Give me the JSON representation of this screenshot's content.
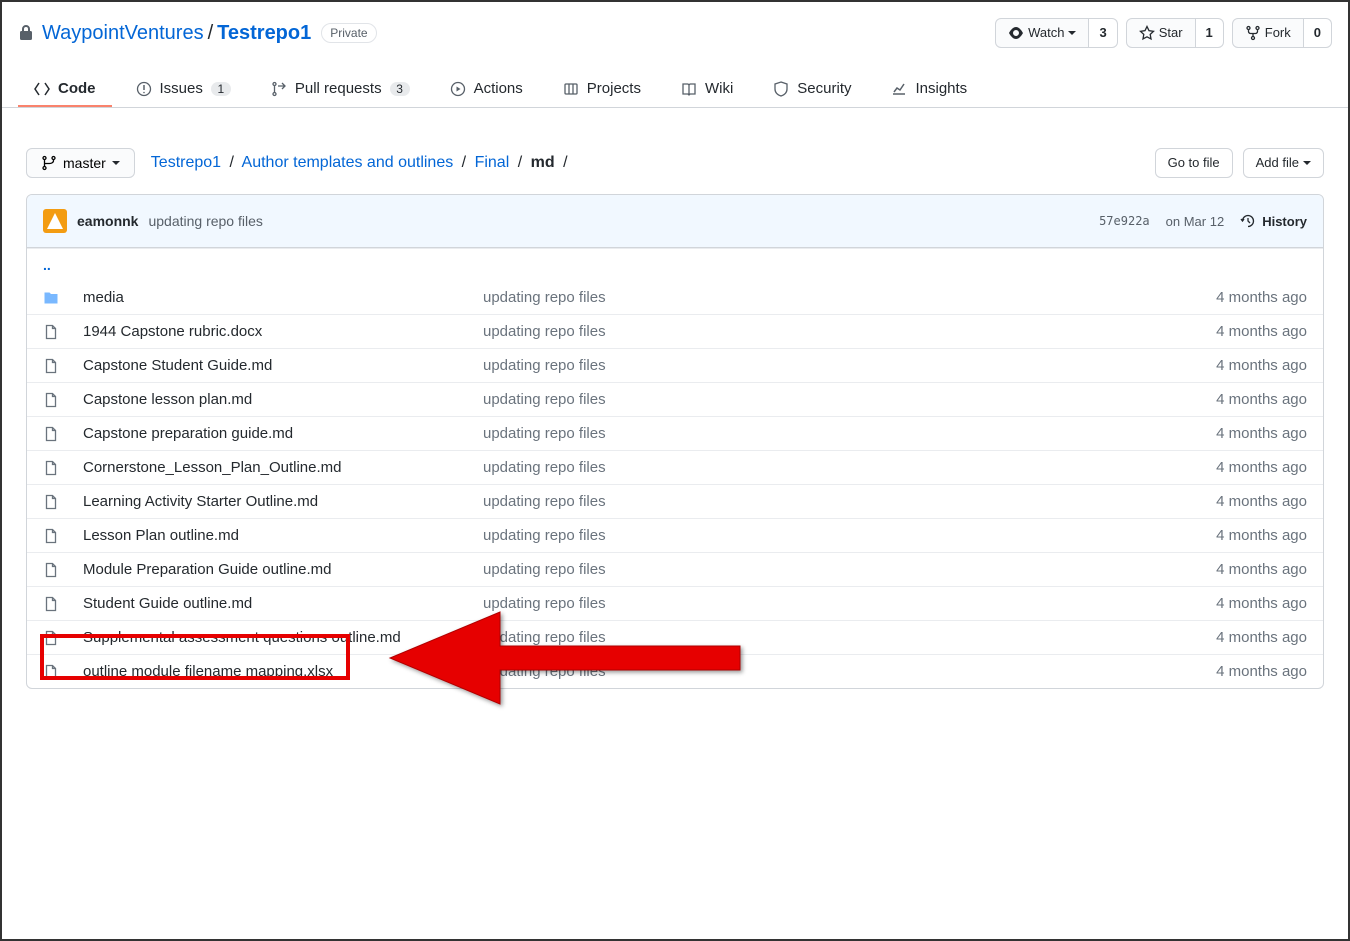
{
  "repo": {
    "owner": "WaypointVentures",
    "name": "Testrepo1",
    "visibility": "Private"
  },
  "actions": {
    "watch": {
      "label": "Watch",
      "count": "3"
    },
    "star": {
      "label": "Star",
      "count": "1"
    },
    "fork": {
      "label": "Fork",
      "count": "0"
    }
  },
  "tabs": [
    {
      "label": "Code"
    },
    {
      "label": "Issues",
      "count": "1"
    },
    {
      "label": "Pull requests",
      "count": "3"
    },
    {
      "label": "Actions"
    },
    {
      "label": "Projects"
    },
    {
      "label": "Wiki"
    },
    {
      "label": "Security"
    },
    {
      "label": "Insights"
    }
  ],
  "branch": "master",
  "breadcrumb": {
    "root": "Testrepo1",
    "parts": [
      "Author templates and outlines",
      "Final"
    ],
    "current": "md"
  },
  "buttons": {
    "goto": "Go to file",
    "addfile": "Add file"
  },
  "commit": {
    "author": "eamonnk",
    "message": "updating repo files",
    "hash": "57e922a",
    "date": "on Mar 12",
    "history": "History"
  },
  "updir": "..",
  "files": [
    {
      "type": "dir",
      "name": "media",
      "msg": "updating repo files",
      "time": "4 months ago"
    },
    {
      "type": "file",
      "name": "1944 Capstone rubric.docx",
      "msg": "updating repo files",
      "time": "4 months ago"
    },
    {
      "type": "file",
      "name": "Capstone Student Guide.md",
      "msg": "updating repo files",
      "time": "4 months ago"
    },
    {
      "type": "file",
      "name": "Capstone lesson plan.md",
      "msg": "updating repo files",
      "time": "4 months ago"
    },
    {
      "type": "file",
      "name": "Capstone preparation guide.md",
      "msg": "updating repo files",
      "time": "4 months ago"
    },
    {
      "type": "file",
      "name": "Cornerstone_Lesson_Plan_Outline.md",
      "msg": "updating repo files",
      "time": "4 months ago"
    },
    {
      "type": "file",
      "name": "Learning Activity Starter Outline.md",
      "msg": "updating repo files",
      "time": "4 months ago"
    },
    {
      "type": "file",
      "name": "Lesson Plan outline.md",
      "msg": "updating repo files",
      "time": "4 months ago"
    },
    {
      "type": "file",
      "name": "Module Preparation Guide outline.md",
      "msg": "updating repo files",
      "time": "4 months ago"
    },
    {
      "type": "file",
      "name": "Student Guide outline.md",
      "msg": "updating repo files",
      "time": "4 months ago"
    },
    {
      "type": "file",
      "name": "Supplemental assessment questions outline.md",
      "msg": "updating repo files",
      "time": "4 months ago"
    },
    {
      "type": "file",
      "name": "outline module filename mapping.xlsx",
      "msg": "updating repo files",
      "time": "4 months ago"
    }
  ],
  "annotation": {
    "highlight_index": 7
  }
}
